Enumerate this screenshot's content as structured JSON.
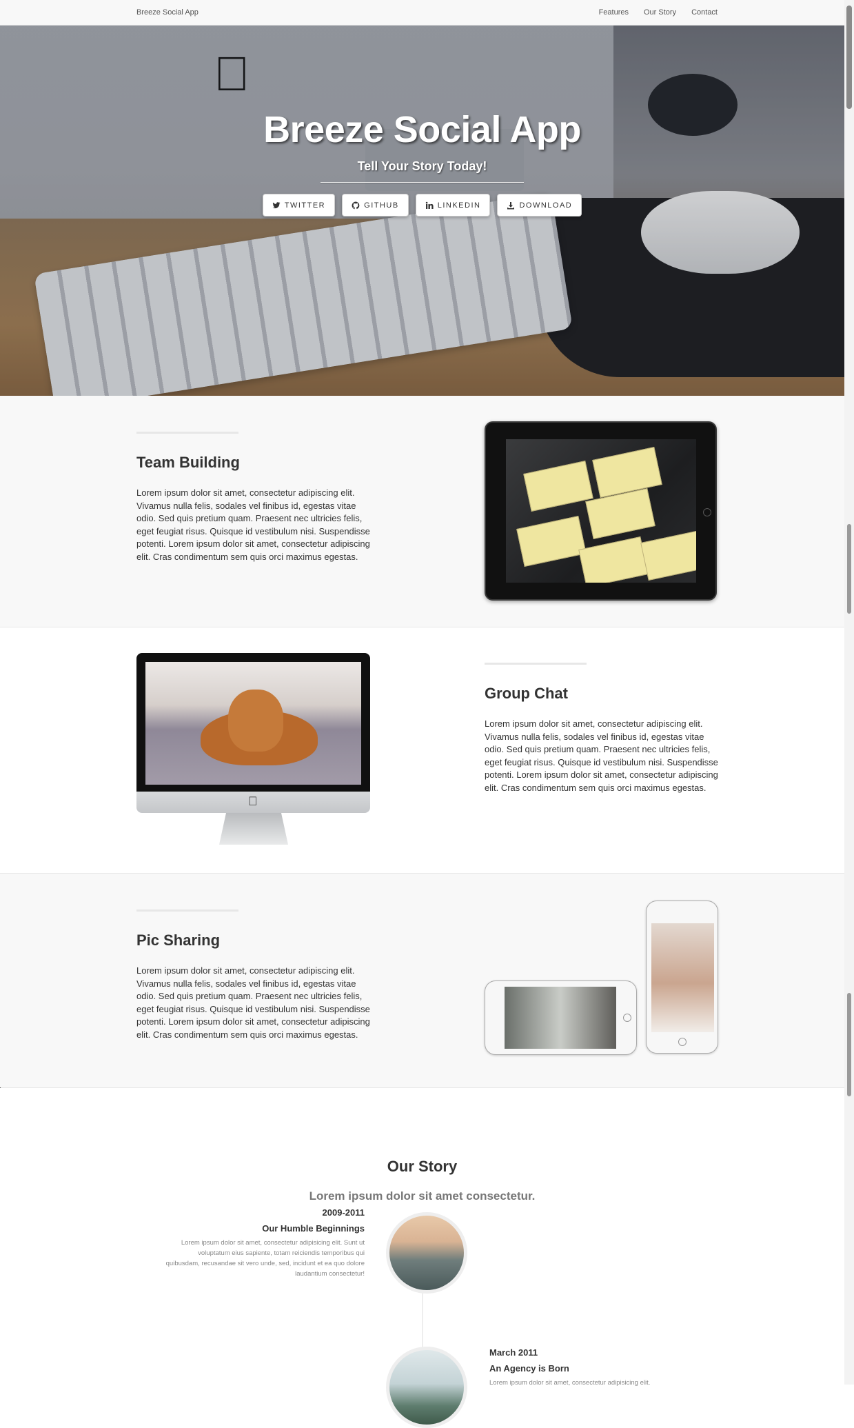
{
  "navbar": {
    "brand": "Breeze Social App",
    "links": [
      "Features",
      "Our Story",
      "Contact"
    ]
  },
  "hero": {
    "title": "Breeze Social App",
    "subtitle": "Tell Your Story Today!",
    "buttons": [
      {
        "label": "TWITTER",
        "icon": "twitter-icon"
      },
      {
        "label": "GITHUB",
        "icon": "github-icon"
      },
      {
        "label": "LINKEDIN",
        "icon": "linkedin-icon"
      },
      {
        "label": "DOWNLOAD",
        "icon": "download-icon"
      }
    ]
  },
  "features": [
    {
      "heading": "Team Building",
      "body": "Lorem ipsum dolor sit amet, consectetur adipiscing elit. Vivamus nulla felis, sodales vel finibus id, egestas vitae odio. Sed quis pretium quam. Praesent nec ultricies felis, eget feugiat risus. Quisque id vestibulum nisi. Suspendisse potenti. Lorem ipsum dolor sit amet, consectetur adipiscing elit. Cras condimentum sem quis orci maximus egestas."
    },
    {
      "heading": "Group Chat",
      "body": "Lorem ipsum dolor sit amet, consectetur adipiscing elit. Vivamus nulla felis, sodales vel finibus id, egestas vitae odio. Sed quis pretium quam. Praesent nec ultricies felis, eget feugiat risus. Quisque id vestibulum nisi. Suspendisse potenti. Lorem ipsum dolor sit amet, consectetur adipiscing elit. Cras condimentum sem quis orci maximus egestas."
    },
    {
      "heading": "Pic Sharing",
      "body": "Lorem ipsum dolor sit amet, consectetur adipiscing elit. Vivamus nulla felis, sodales vel finibus id, egestas vitae odio. Sed quis pretium quam. Praesent nec ultricies felis, eget feugiat risus. Quisque id vestibulum nisi. Suspendisse potenti. Lorem ipsum dolor sit amet, consectetur adipiscing elit. Cras condimentum sem quis orci maximus egestas."
    }
  ],
  "story": {
    "corner_char": "\\",
    "title": "Our Story",
    "subtitle": "Lorem ipsum dolor sit amet consectetur.",
    "timeline": [
      {
        "date": "2009-2011",
        "heading": "Our Humble Beginnings",
        "body": "Lorem ipsum dolor sit amet, consectetur adipisicing elit. Sunt ut voluptatum eius sapiente, totam reiciendis temporibus qui quibusdam, recusandae sit vero unde, sed, incidunt et ea quo dolore laudantium consectetur!"
      },
      {
        "date": "March 2011",
        "heading": "An Agency is Born",
        "body": "Lorem ipsum dolor sit amet, consectetur adipisicing elit."
      }
    ]
  }
}
